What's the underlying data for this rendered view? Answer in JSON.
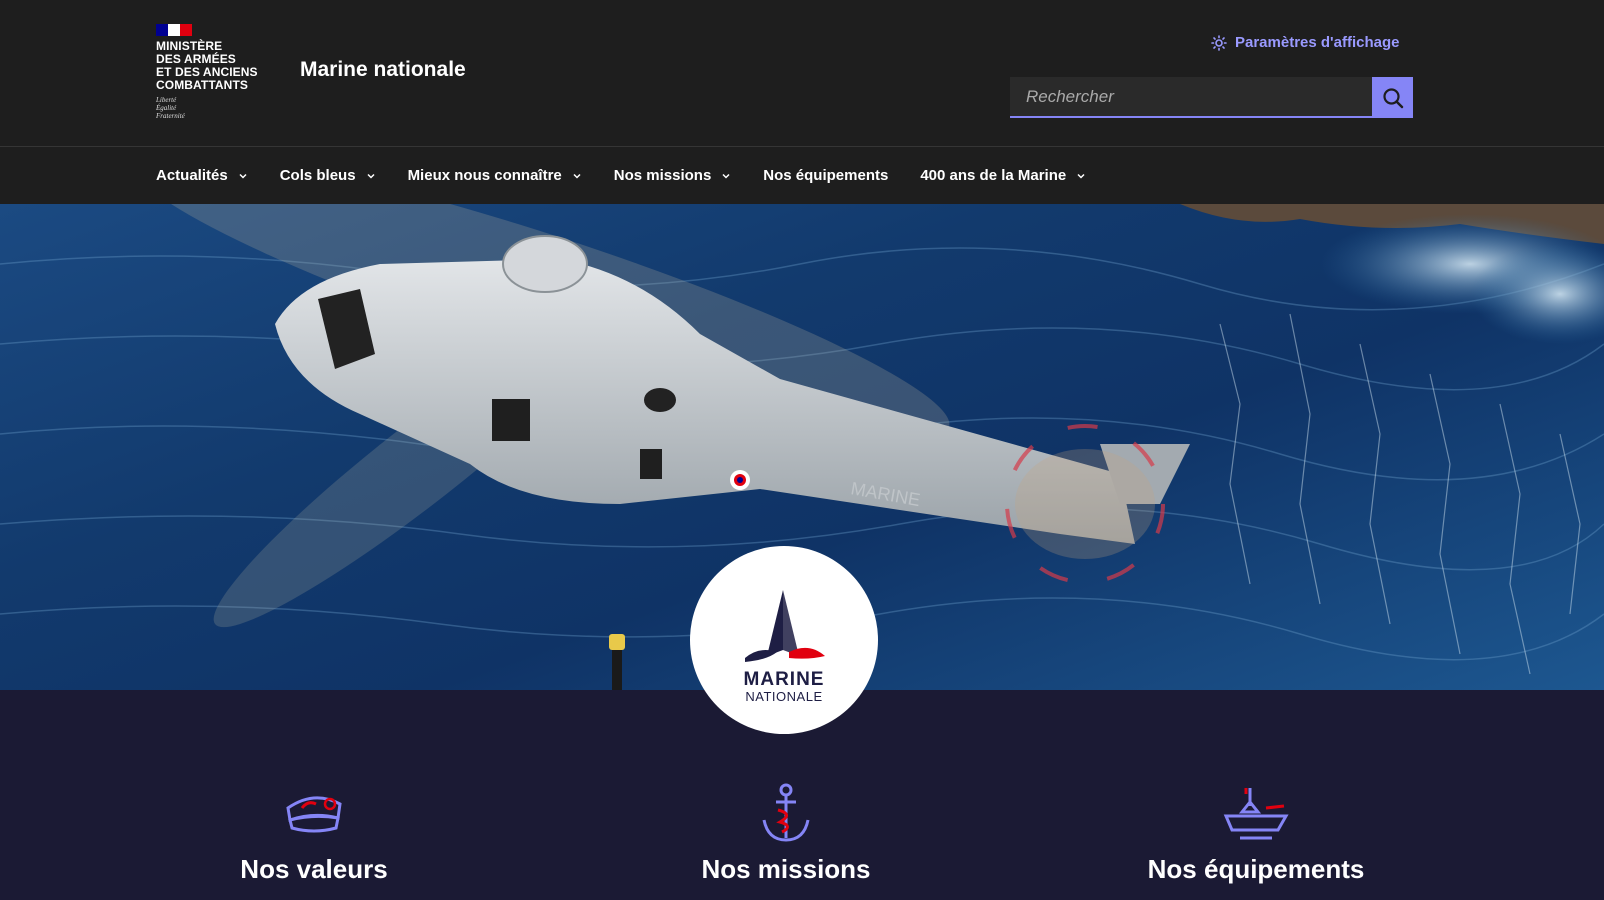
{
  "header": {
    "ministry_name": "Ministère\ndes armées\net des anciens\ncombattants",
    "motto": "Liberté\nÉgalité\nFraternité",
    "site_title": "Marine nationale",
    "display_settings_label": "Paramètres d'affichage",
    "search": {
      "placeholder": "Rechercher"
    }
  },
  "nav": {
    "items": [
      {
        "label": "Actualités",
        "has_dropdown": true
      },
      {
        "label": "Cols bleus",
        "has_dropdown": true
      },
      {
        "label": "Mieux nous connaître",
        "has_dropdown": true
      },
      {
        "label": "Nos missions",
        "has_dropdown": true
      },
      {
        "label": "Nos équipements",
        "has_dropdown": false
      },
      {
        "label": "400 ans de la Marine",
        "has_dropdown": true
      }
    ]
  },
  "hero": {
    "image_subject": "navy helicopter over the sea",
    "helicopter_marking": "MARINE",
    "logo": {
      "line1": "MARINE",
      "line2": "NATIONALE"
    }
  },
  "features": [
    {
      "title": "Nos valeurs",
      "icon": "sailor-cap-icon"
    },
    {
      "title": "Nos missions",
      "icon": "anchor-icon"
    },
    {
      "title": "Nos équipements",
      "icon": "warship-icon"
    }
  ],
  "colors": {
    "header_bg": "#1e1e1e",
    "accent": "#8585f6",
    "features_bg": "#1b1a34",
    "flag_blue": "#000091",
    "flag_red": "#e1000f",
    "icon_red": "#e1000f"
  }
}
